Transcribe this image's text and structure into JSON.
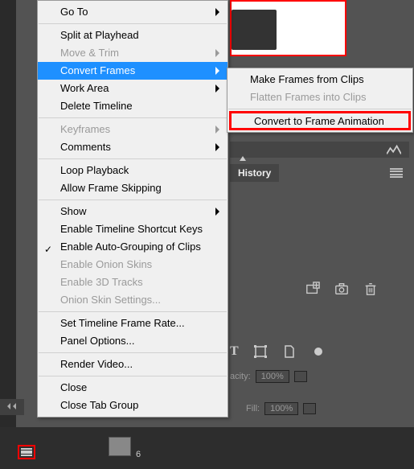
{
  "main_menu": {
    "goto": "Go To",
    "split": "Split at Playhead",
    "move_trim": "Move & Trim",
    "convert_frames": "Convert Frames",
    "work_area": "Work Area",
    "delete_timeline": "Delete Timeline",
    "keyframes": "Keyframes",
    "comments": "Comments",
    "loop_playback": "Loop Playback",
    "allow_frame_skip": "Allow Frame Skipping",
    "show": "Show",
    "enable_shortcut": "Enable Timeline Shortcut Keys",
    "enable_autogroup": "Enable Auto-Grouping of Clips",
    "enable_onion": "Enable Onion Skins",
    "enable_3d": "Enable 3D Tracks",
    "onion_settings": "Onion Skin Settings...",
    "set_framerate": "Set Timeline Frame Rate...",
    "panel_options": "Panel Options...",
    "render_video": "Render Video...",
    "close": "Close",
    "close_tab_group": "Close Tab Group"
  },
  "sub_menu": {
    "make_frames": "Make Frames from Clips",
    "flatten_frames": "Flatten Frames into Clips",
    "convert_anim": "Convert to Frame Animation"
  },
  "panels": {
    "history_tab": "History",
    "opacity_label": "acity:",
    "opacity_value": "100%",
    "fill_label": "Fill:",
    "fill_value": "100%",
    "frame_count": "6"
  }
}
